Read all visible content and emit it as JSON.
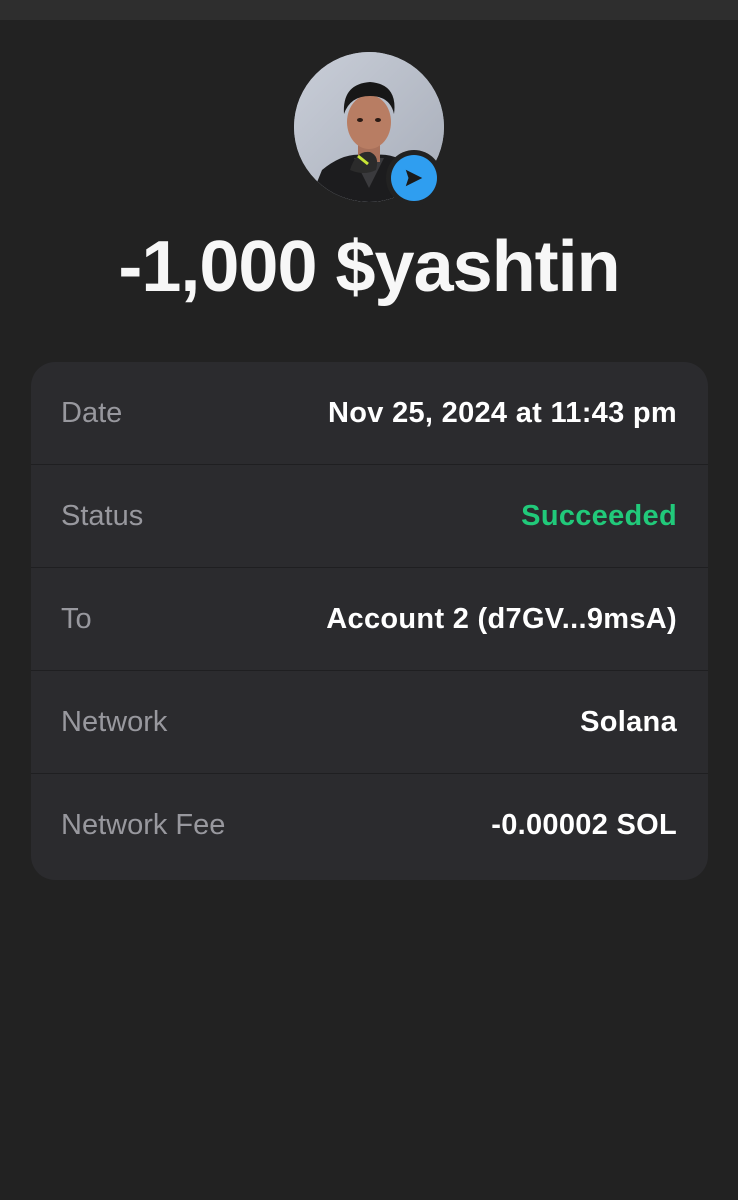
{
  "amount": "-1,000 $yashtin",
  "avatar": {
    "icon": "user-avatar-photo",
    "badge_icon": "send-arrow-icon",
    "badge_color": "#2f9ef0"
  },
  "details": [
    {
      "label": "Date",
      "value": "Nov 25, 2024 at 11:43 pm"
    },
    {
      "label": "Status",
      "value": "Succeeded",
      "value_color": "#21c97a"
    },
    {
      "label": "To",
      "value": "Account 2 (d7GV...9msA)"
    },
    {
      "label": "Network",
      "value": "Solana"
    },
    {
      "label": "Network Fee",
      "value": "-0.00002 SOL"
    }
  ]
}
